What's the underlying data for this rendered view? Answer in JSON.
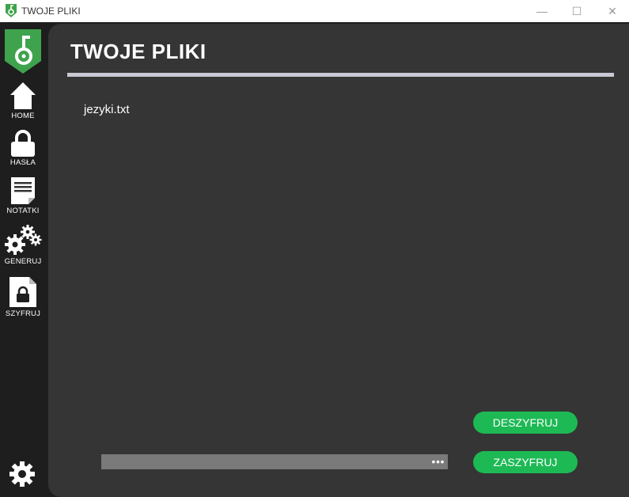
{
  "window": {
    "title": "TWOJE PLIKI",
    "controls": {
      "minimize": "—",
      "maximize": "☐",
      "close": "✕"
    }
  },
  "sidebar": {
    "logo_icon": "key-shield-icon",
    "items": [
      {
        "label": "HOME",
        "icon": "home-icon"
      },
      {
        "label": "HASŁA",
        "icon": "lock-icon"
      },
      {
        "label": "NOTATKI",
        "icon": "note-icon"
      },
      {
        "label": "GENERUJ",
        "icon": "gears-icon"
      },
      {
        "label": "SZYFRUJ",
        "icon": "locked-file-icon"
      }
    ],
    "settings_icon": "gear-icon"
  },
  "main": {
    "title": "TWOJE PLIKI",
    "files": [
      "jezyki.txt"
    ],
    "path_input": {
      "value": "",
      "browse_label": "•••"
    },
    "buttons": {
      "decrypt": "DESZYFRUJ",
      "encrypt": "ZASZYFRUJ"
    }
  },
  "colors": {
    "accent": "#1db954",
    "sidebar_bg": "#1e1e1e",
    "panel_bg": "#353535",
    "divider": "#c9c9d6",
    "input_bg": "#7a7a7a"
  }
}
